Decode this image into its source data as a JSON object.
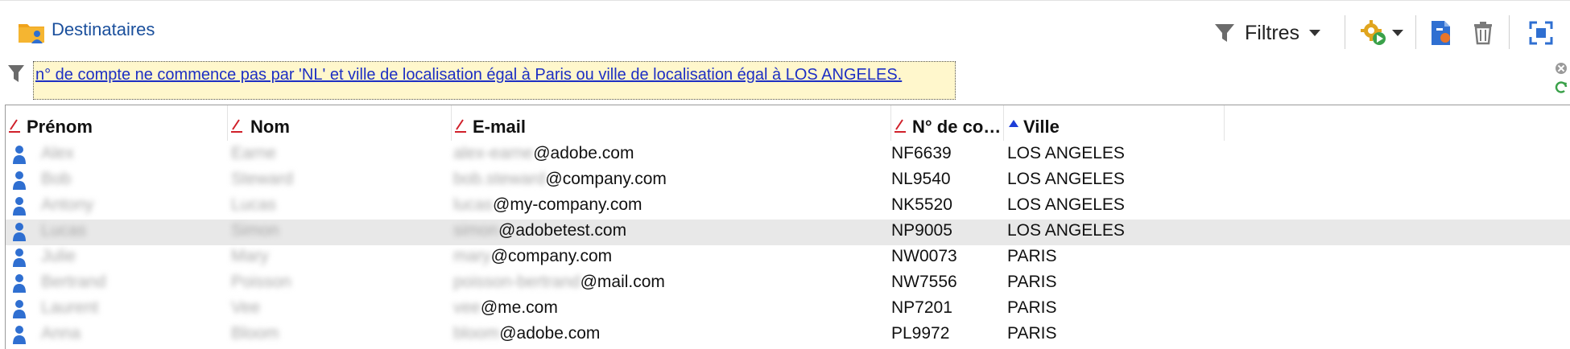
{
  "toolbar": {
    "title": "Destinataires",
    "filter_label": "Filtres"
  },
  "filter": {
    "expression": "n° de compte ne commence pas par 'NL' et ville de localisation égal à Paris ou ville de localisation égal à LOS ANGELES."
  },
  "columns": [
    {
      "label": "Prénom"
    },
    {
      "label": "Nom"
    },
    {
      "label": "E-mail"
    },
    {
      "label": "N° de co…"
    },
    {
      "label": "Ville"
    }
  ],
  "rows": [
    {
      "first": "Alex",
      "last": "Earne",
      "email_user": "alex-earne",
      "email_domain": "@adobe.com",
      "account": "NF6639",
      "city": "LOS ANGELES"
    },
    {
      "first": "Bob",
      "last": "Steward",
      "email_user": "bob.steward",
      "email_domain": "@company.com",
      "account": "NL9540",
      "city": "LOS ANGELES"
    },
    {
      "first": "Antony",
      "last": "Lucas",
      "email_user": "lucas",
      "email_domain": "@my-company.com",
      "account": "NK5520",
      "city": "LOS ANGELES"
    },
    {
      "first": "Lucas",
      "last": "Simon",
      "email_user": "simon",
      "email_domain": "@adobetest.com",
      "account": "NP9005",
      "city": "LOS ANGELES"
    },
    {
      "first": "Julie",
      "last": "Mary",
      "email_user": "mary",
      "email_domain": "@company.com",
      "account": "NW0073",
      "city": "PARIS"
    },
    {
      "first": "Bertrand",
      "last": "Poisson",
      "email_user": "poisson-bertrand",
      "email_domain": "@mail.com",
      "account": "NW7556",
      "city": "PARIS"
    },
    {
      "first": "Laurent",
      "last": "Vee",
      "email_user": "vee",
      "email_domain": "@me.com",
      "account": "NP7201",
      "city": "PARIS"
    },
    {
      "first": "Anna",
      "last": "Bloom",
      "email_user": "bloom",
      "email_domain": "@adobe.com",
      "account": "PL9972",
      "city": "PARIS"
    }
  ],
  "colors": {
    "title": "#1a4f9c",
    "filter_link": "#1d2fc4",
    "filter_bg": "#fff7cc",
    "person_icon": "#2f6fd1",
    "pencil_icon": "#d0202a",
    "sort_icon": "#1d3ed8",
    "selected_row": "#e8e8e8"
  },
  "icons": {
    "app": "folder-user-icon",
    "filter": "funnel-icon",
    "actions": "gear-play-icon",
    "export": "document-export-icon",
    "delete": "trash-icon",
    "fullscreen": "fullscreen-icon",
    "clear_filter": "close-icon",
    "refresh": "refresh-icon",
    "row": "person-icon",
    "column_edit": "pencil-icon",
    "sort": "sort-ascending-icon"
  }
}
